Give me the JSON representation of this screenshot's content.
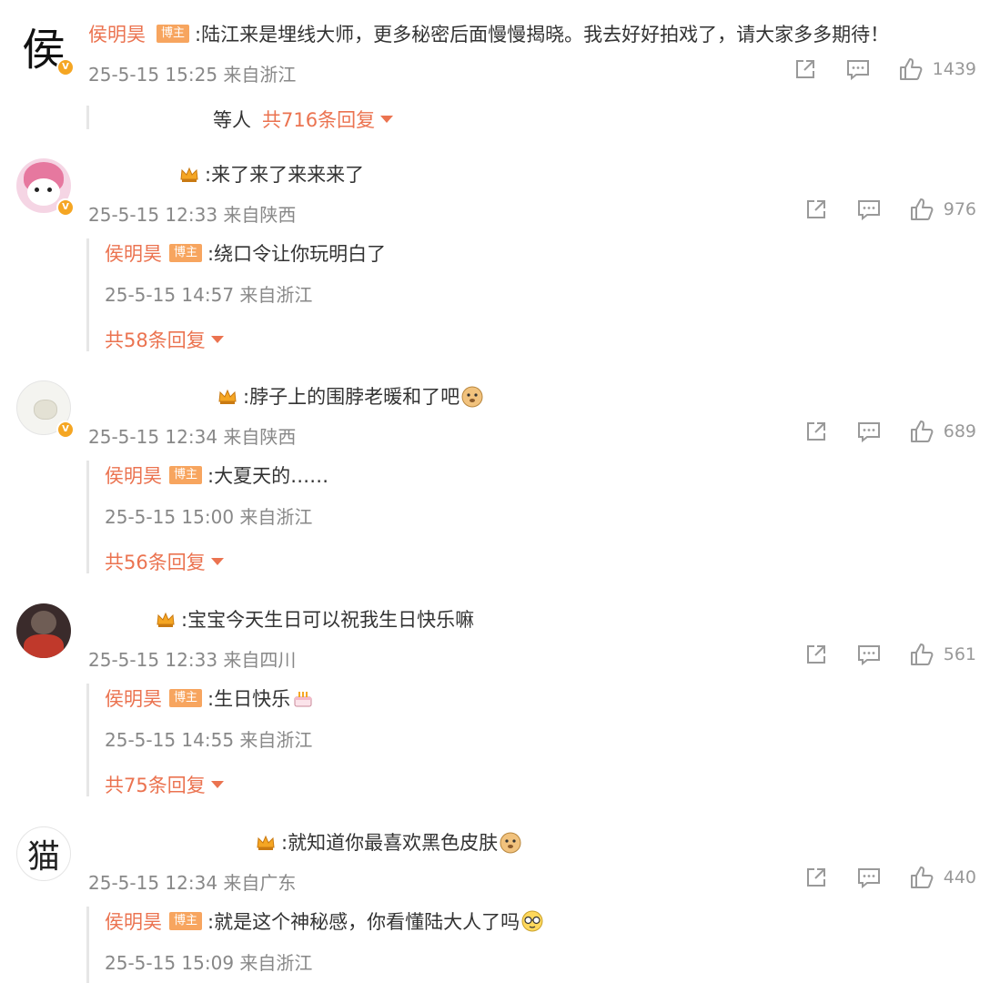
{
  "comments": [
    {
      "user": "侯明昊",
      "badge": "博主",
      "text": ":陆江来是埋线大师，更多秘密后面慢慢揭晓。我去好好拍戏了，请大家多多期待！",
      "meta": "25-5-15 15:25 来自浙江",
      "likes": "1439",
      "avatar_char": "侯",
      "more_prefix": "等人",
      "more_label": "共716条回复"
    },
    {
      "text": ":来了来了来来来了",
      "meta": "25-5-15 12:33 来自陕西",
      "likes": "976",
      "reply": {
        "user": "侯明昊",
        "badge": "博主",
        "text": ":绕口令让你玩明白了",
        "meta": "25-5-15 14:57 来自浙江"
      },
      "more_label": "共58条回复"
    },
    {
      "text": ":脖子上的围脖老暖和了吧",
      "meta": "25-5-15 12:34 来自陕西",
      "likes": "689",
      "reply": {
        "user": "侯明昊",
        "badge": "博主",
        "text": ":大夏天的……",
        "meta": "25-5-15 15:00 来自浙江"
      },
      "more_label": "共56条回复"
    },
    {
      "text": ":宝宝今天生日可以祝我生日快乐嘛",
      "meta": "25-5-15 12:33 来自四川",
      "likes": "561",
      "reply": {
        "user": "侯明昊",
        "badge": "博主",
        "text": ":生日快乐",
        "meta": "25-5-15 14:55 来自浙江"
      },
      "more_label": "共75条回复"
    },
    {
      "text": ":就知道你最喜欢黑色皮肤",
      "meta": "25-5-15 12:34 来自广东",
      "likes": "440",
      "avatar_char": "猫",
      "reply": {
        "user": "侯明昊",
        "badge": "博主",
        "text": ":就是这个神秘感，你看懂陆大人了吗",
        "meta": "25-5-15 15:09 来自浙江"
      }
    }
  ],
  "colors": {
    "accent": "#eb7350",
    "badge": "#f7a55f",
    "meta": "#888888",
    "icon": "#999999"
  },
  "icons": [
    "share-icon",
    "comment-icon",
    "like-icon",
    "vip-crown-icon",
    "verified-badge-icon",
    "dropdown-caret-icon"
  ]
}
